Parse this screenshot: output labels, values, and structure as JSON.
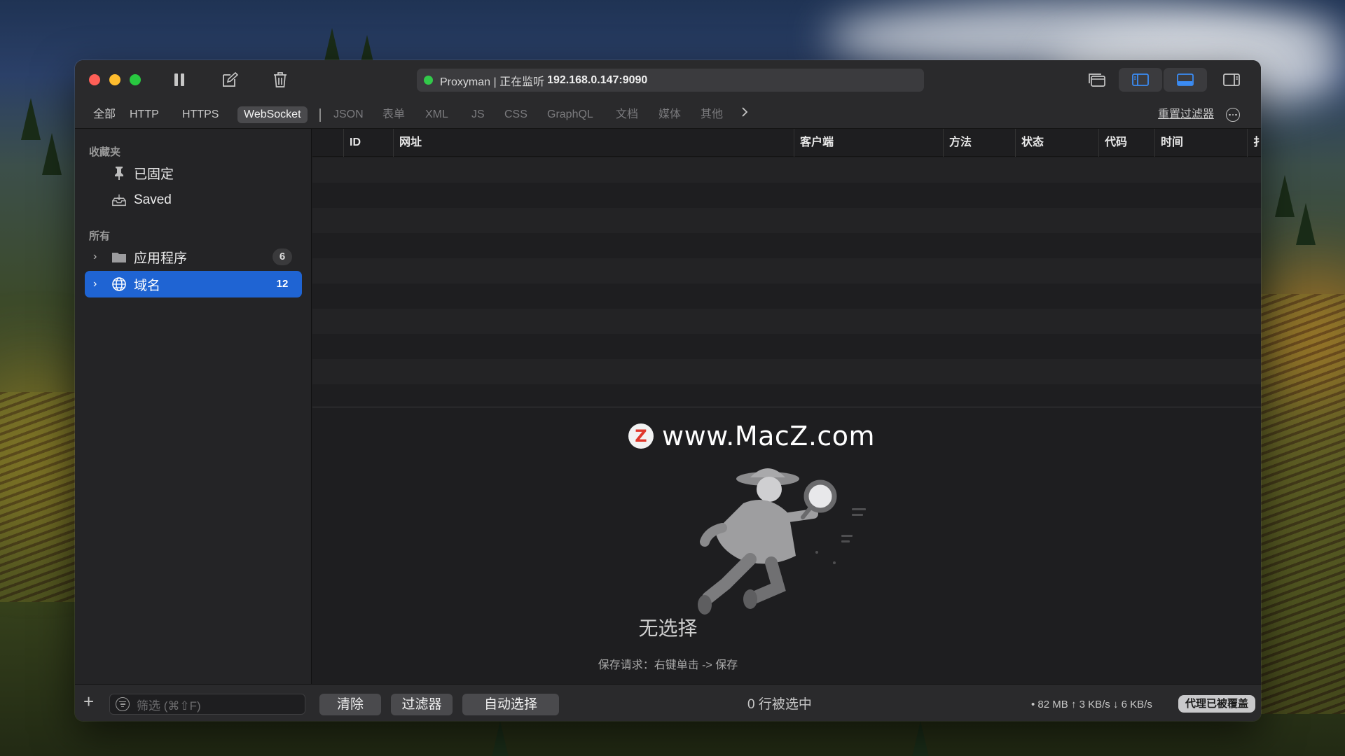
{
  "window": {
    "address_prefix": "Proxyman | 正在监听",
    "address_ip": "192.168.0.147:9090"
  },
  "tabs": [
    {
      "label": "全部"
    },
    {
      "label": "HTTP"
    },
    {
      "label": "HTTPS"
    },
    {
      "label": "WebSocket"
    },
    {
      "label": "JSON"
    },
    {
      "label": "表单"
    },
    {
      "label": "XML"
    },
    {
      "label": "JS"
    },
    {
      "label": "CSS"
    },
    {
      "label": "GraphQL"
    },
    {
      "label": "文档"
    },
    {
      "label": "媒体"
    },
    {
      "label": "其他"
    }
  ],
  "active_tab": "WebSocket",
  "reset_filter_label": "重置过滤器",
  "sidebar": {
    "favorites_title": "收藏夹",
    "pinned_label": "已固定",
    "saved_label": "Saved",
    "all_title": "所有",
    "apps_label": "应用程序",
    "apps_count": "6",
    "domains_label": "域名",
    "domains_count": "12"
  },
  "table": {
    "columns": [
      "ID",
      "网址",
      "客户端",
      "方法",
      "状态",
      "代码",
      "时间",
      "扌"
    ]
  },
  "empty": {
    "title": "无选择",
    "hint": "保存请求：右键单击 -> 保存"
  },
  "bottom": {
    "search_placeholder": "筛选 (⌘⇧F)",
    "clear_label": "清除",
    "filter_label": "过滤器",
    "autoselect_label": "自动选择",
    "selected_text": "0 行被选中",
    "stats_text": "• 82 MB ↑ 3 KB/s ↓ 6 KB/s",
    "proxy_badge": "代理已被覆盖"
  },
  "watermark": {
    "logo_letter": "Z",
    "text": "www.MacZ.com"
  },
  "colors": {
    "accent": "#1f64d3",
    "status_green": "#32c94a",
    "close": "#fe5f57",
    "minimize": "#febc2e",
    "maximize": "#28c840"
  }
}
